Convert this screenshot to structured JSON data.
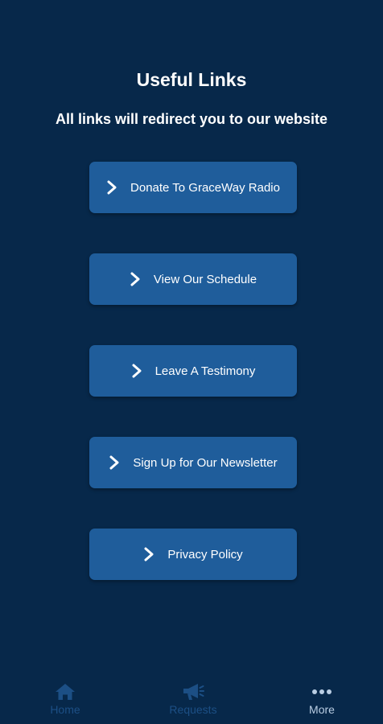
{
  "header": {
    "title": "Useful Links",
    "subtitle": "All links will redirect you to our website"
  },
  "links": [
    {
      "label": "Donate To GraceWay Radio",
      "icon": "chevron-right-icon"
    },
    {
      "label": "View Our Schedule",
      "icon": "chevron-right-icon"
    },
    {
      "label": "Leave A Testimony",
      "icon": "chevron-right-icon"
    },
    {
      "label": "Sign Up for Our Newsletter",
      "icon": "chevron-right-icon"
    },
    {
      "label": "Privacy Policy",
      "icon": "chevron-right-icon"
    }
  ],
  "tabbar": {
    "tabs": [
      {
        "label": "Home",
        "icon": "home-icon",
        "active": false
      },
      {
        "label": "Requests",
        "icon": "megaphone-icon",
        "active": false
      },
      {
        "label": "More",
        "icon": "more-dots-icon",
        "active": true
      }
    ]
  },
  "colors": {
    "background": "#07284a",
    "button": "#1f5d9b",
    "tab_inactive": "#1c4f85",
    "tab_active": "#b9cde3"
  }
}
